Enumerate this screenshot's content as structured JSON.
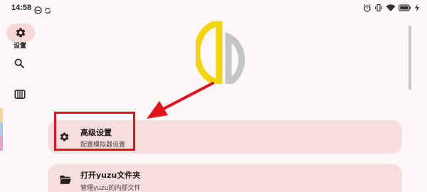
{
  "status_bar": {
    "time": "14:58",
    "left_icons": [
      "dnd-icon",
      "sync-icon"
    ],
    "right_icons": [
      "alarm-icon",
      "vibrate-icon",
      "wifi-icon",
      "battery-icon",
      "charging-icon"
    ]
  },
  "nav": {
    "items": [
      {
        "id": "settings",
        "label": "设置",
        "icon": "gear-icon",
        "selected": true
      },
      {
        "id": "search",
        "label": "",
        "icon": "search-icon",
        "selected": false
      },
      {
        "id": "games",
        "label": "",
        "icon": "game-library-icon",
        "selected": false
      }
    ]
  },
  "logo": {
    "name": "yuzu-logo",
    "colors": {
      "left": "#f2d40f",
      "right": "#c5c5c5"
    }
  },
  "settings_list": [
    {
      "title": "高级设置",
      "subtitle": "配置模拟器设置",
      "icon": "gear-icon"
    },
    {
      "title": "打开yuzu文件夹",
      "subtitle": "管理yuzu的内部文件",
      "icon": "folder-icon"
    }
  ],
  "annotation": {
    "highlight_color": "#e1141b",
    "arrow_color": "#e1141b"
  },
  "colors": {
    "background": "#fbf8f7",
    "card": "#f7dede",
    "nav_selected": "#f6d9d6",
    "edge_strip": [
      "#f3d5a4",
      "#a9c9e8",
      "#e7a6c9"
    ]
  }
}
